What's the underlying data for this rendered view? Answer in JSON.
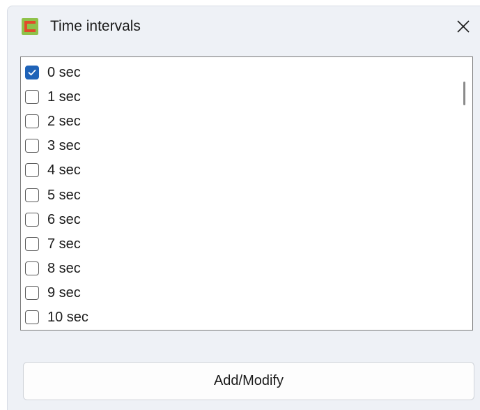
{
  "window": {
    "title": "Time intervals",
    "icon": "app-c-icon",
    "close_icon": "close-icon"
  },
  "list": {
    "items": [
      {
        "label": "0 sec",
        "checked": true
      },
      {
        "label": "1 sec",
        "checked": false
      },
      {
        "label": "2 sec",
        "checked": false
      },
      {
        "label": "3 sec",
        "checked": false
      },
      {
        "label": "4 sec",
        "checked": false
      },
      {
        "label": "5 sec",
        "checked": false
      },
      {
        "label": "6 sec",
        "checked": false
      },
      {
        "label": "7 sec",
        "checked": false
      },
      {
        "label": "8 sec",
        "checked": false
      },
      {
        "label": "9 sec",
        "checked": false
      },
      {
        "label": "10 sec",
        "checked": false
      }
    ]
  },
  "actions": {
    "add_modify_label": "Add/Modify"
  },
  "colors": {
    "accent": "#1f63b8",
    "icon_green": "#8fc24a",
    "icon_red": "#e24b2a"
  }
}
